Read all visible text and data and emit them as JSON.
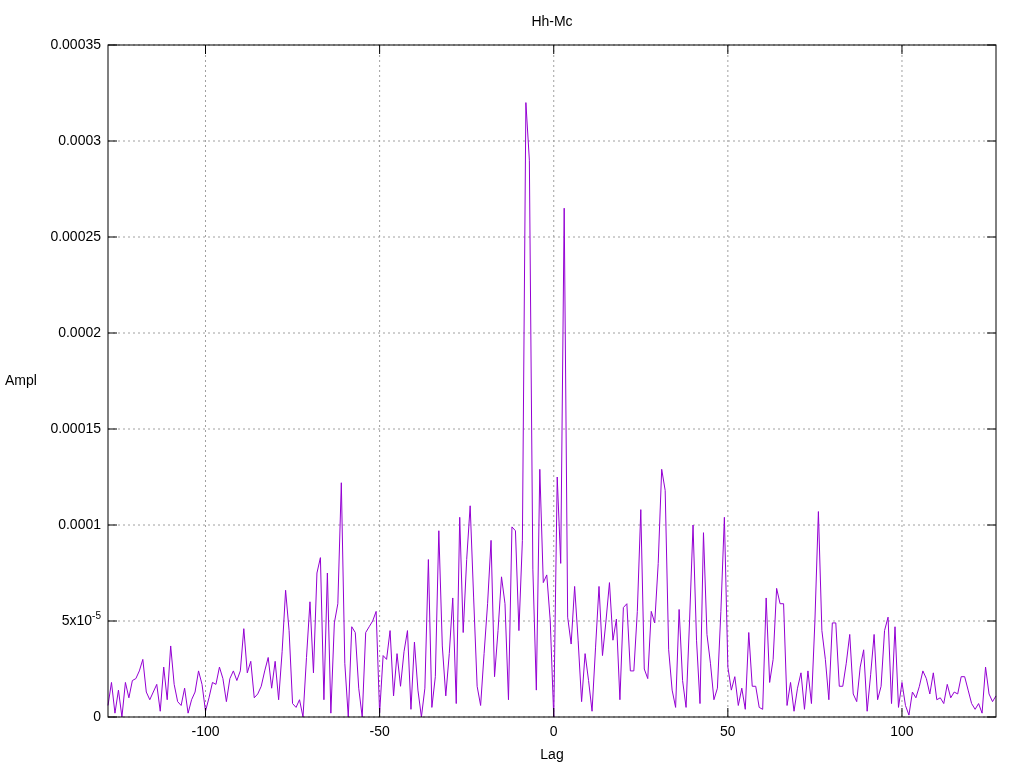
{
  "plot": {
    "chart_data": {
      "type": "line",
      "title": "Hh-Mc",
      "xlabel": "Lag",
      "ylabel": "Ampl",
      "xlim": [
        -128,
        127
      ],
      "ylim": [
        0,
        0.00035
      ],
      "grid": true,
      "xticks": [
        -100,
        -50,
        0,
        50,
        100
      ],
      "yticks": [
        {
          "value": 0,
          "label": "0"
        },
        {
          "value": 5e-05,
          "label": "5x10$^{-5}$"
        },
        {
          "value": 0.0001,
          "label": "0.0001"
        },
        {
          "value": 0.00015,
          "label": "0.00015"
        },
        {
          "value": 0.0002,
          "label": "0.0002"
        },
        {
          "value": 0.00025,
          "label": "0.00025"
        },
        {
          "value": 0.0003,
          "label": "0.0003"
        },
        {
          "value": 0.00035,
          "label": "0.00035"
        }
      ],
      "x": [
        -128,
        -127,
        -126,
        -125,
        -124,
        -123,
        -122,
        -121,
        -120,
        -119,
        -118,
        -117,
        -116,
        -115,
        -114,
        -113,
        -112,
        -111,
        -110,
        -109,
        -108,
        -107,
        -106,
        -105,
        -104,
        -103,
        -102,
        -101,
        -100,
        -99,
        -98,
        -97,
        -96,
        -95,
        -94,
        -93,
        -92,
        -91,
        -90,
        -89,
        -88,
        -87,
        -86,
        -85,
        -84,
        -83,
        -82,
        -81,
        -80,
        -79,
        -78,
        -77,
        -76,
        -75,
        -74,
        -73,
        -72,
        -71,
        -70,
        -69,
        -68,
        -67,
        -66,
        -65,
        -64,
        -63,
        -62,
        -61,
        -60,
        -59,
        -58,
        -57,
        -56,
        -55,
        -54,
        -53,
        -52,
        -51,
        -50,
        -49,
        -48,
        -47,
        -46,
        -45,
        -44,
        -43,
        -42,
        -41,
        -40,
        -39,
        -38,
        -37,
        -36,
        -35,
        -34,
        -33,
        -32,
        -31,
        -30,
        -29,
        -28,
        -27,
        -26,
        -25,
        -24,
        -23,
        -22,
        -21,
        -20,
        -19,
        -18,
        -17,
        -16,
        -15,
        -14,
        -13,
        -12,
        -11,
        -10,
        -9,
        -8,
        -7,
        -6,
        -5,
        -4,
        -3,
        -2,
        -1,
        0,
        1,
        2,
        3,
        4,
        5,
        6,
        7,
        8,
        9,
        10,
        11,
        12,
        13,
        14,
        15,
        16,
        17,
        18,
        19,
        20,
        21,
        22,
        23,
        24,
        25,
        26,
        27,
        28,
        29,
        30,
        31,
        32,
        33,
        34,
        35,
        36,
        37,
        38,
        39,
        40,
        41,
        42,
        43,
        44,
        45,
        46,
        47,
        48,
        49,
        50,
        51,
        52,
        53,
        54,
        55,
        56,
        57,
        58,
        59,
        60,
        61,
        62,
        63,
        64,
        65,
        66,
        67,
        68,
        69,
        70,
        71,
        72,
        73,
        74,
        75,
        76,
        77,
        78,
        79,
        80,
        81,
        82,
        83,
        84,
        85,
        86,
        87,
        88,
        89,
        90,
        91,
        92,
        93,
        94,
        95,
        96,
        97,
        98,
        99,
        100,
        101,
        102,
        103,
        104,
        105,
        106,
        107,
        108,
        109,
        110,
        111,
        112,
        113,
        114,
        115,
        116,
        117,
        118,
        119,
        120,
        121,
        122,
        123,
        124,
        125,
        126,
        127
      ],
      "series": [
        {
          "color": "#9400d3",
          "values": [
            6e-06,
            1.8e-05,
            2e-06,
            1.4e-05,
            0,
            1.8e-05,
            1e-05,
            1.9e-05,
            2e-05,
            2.4e-05,
            3e-05,
            1.3e-05,
            9e-06,
            1.3e-05,
            1.7e-05,
            3e-06,
            2.6e-05,
            9e-06,
            3.7e-05,
            1.7e-05,
            8e-06,
            6e-06,
            1.5e-05,
            2e-06,
            9e-06,
            1.3e-05,
            2.4e-05,
            1.7e-05,
            3e-06,
            1e-05,
            1.8e-05,
            1.7e-05,
            2.6e-05,
            2e-05,
            8e-06,
            2e-05,
            2.4e-05,
            1.9e-05,
            2.4e-05,
            4.6e-05,
            2.3e-05,
            2.9e-05,
            1e-05,
            1.2e-05,
            1.6e-05,
            2.4e-05,
            3.1e-05,
            1.5e-05,
            2.9e-05,
            9e-06,
            3.4e-05,
            6.6e-05,
            4.5e-05,
            7e-06,
            5e-06,
            9e-06,
            0,
            3.1e-05,
            6e-05,
            2.3e-05,
            7.5e-05,
            8.3e-05,
            9e-06,
            7.5e-05,
            2e-06,
            4.9e-05,
            5.9e-05,
            0.000122,
            2.8e-05,
            0,
            4.7e-05,
            4.4e-05,
            1.5e-05,
            0,
            4.4e-05,
            4.7e-05,
            5e-05,
            5.5e-05,
            2e-06,
            3.2e-05,
            3e-05,
            4.5e-05,
            1.1e-05,
            3.3e-05,
            1.6e-05,
            3.4e-05,
            4.5e-05,
            4e-06,
            3.9e-05,
            1.4e-05,
            0,
            1.5e-05,
            8.2e-05,
            5e-06,
            2.1e-05,
            9.7e-05,
            3.7e-05,
            1.1e-05,
            3.3e-05,
            6.2e-05,
            7e-06,
            0.000104,
            4.4e-05,
            8.2e-05,
            0.00011,
            6.2e-05,
            1.6e-05,
            6e-06,
            3.3e-05,
            5.9e-05,
            9.2e-05,
            2.1e-05,
            4.5e-05,
            7.3e-05,
            5.9e-05,
            9e-06,
            9.9e-05,
            9.7e-05,
            4.5e-05,
            9.2e-05,
            0.00032,
            0.00029,
            7.7e-05,
            1.4e-05,
            0.000129,
            7e-05,
            7.4e-05,
            5e-05,
            0,
            0.000125,
            8e-05,
            0.000265,
            5.2e-05,
            3.8e-05,
            6.8e-05,
            4e-05,
            8e-06,
            3.3e-05,
            1.9e-05,
            3e-06,
            3.6e-05,
            6.8e-05,
            3.2e-05,
            5e-05,
            7e-05,
            4e-05,
            5.1e-05,
            9e-06,
            5.7e-05,
            5.9e-05,
            2.4e-05,
            2.4e-05,
            5.5e-05,
            0.000108,
            2.5e-05,
            2e-05,
            5.5e-05,
            4.9e-05,
            8e-05,
            0.000129,
            0.000118,
            3.5e-05,
            1.4e-05,
            5e-06,
            5.6e-05,
            1.9e-05,
            5e-06,
            5e-05,
            0.0001,
            4e-05,
            7e-06,
            9.6e-05,
            4.3e-05,
            2.8e-05,
            9e-06,
            1.5e-05,
            5.5e-05,
            0.000104,
            2.6e-05,
            1.4e-05,
            2.1e-05,
            6e-06,
            1.5e-05,
            4e-06,
            4.4e-05,
            1.6e-05,
            1.6e-05,
            5e-06,
            4e-06,
            6.2e-05,
            1.8e-05,
            3e-05,
            6.7e-05,
            5.9e-05,
            5.9e-05,
            6e-06,
            1.8e-05,
            3e-06,
            1.5e-05,
            2.3e-05,
            4e-06,
            2.4e-05,
            7e-06,
            5e-05,
            0.000107,
            4.5e-05,
            3e-05,
            9e-06,
            4.9e-05,
            4.9e-05,
            1.6e-05,
            1.6e-05,
            2.8e-05,
            4.3e-05,
            1.2e-05,
            8e-06,
            2.6e-05,
            3.5e-05,
            3e-06,
            2.2e-05,
            4.3e-05,
            9e-06,
            1.6e-05,
            4.5e-05,
            5.2e-05,
            7e-06,
            4.7e-05,
            5e-06,
            1.8e-05,
            6e-06,
            1e-06,
            1.3e-05,
            1e-05,
            1.6e-05,
            2.4e-05,
            2e-05,
            1.2e-05,
            2.3e-05,
            9e-06,
            1e-05,
            7e-06,
            1.7e-05,
            1e-05,
            1.3e-05,
            1.2e-05,
            2.1e-05,
            2.1e-05,
            1.4e-05,
            7e-06,
            4e-06,
            7e-06,
            2e-06,
            2.6e-05,
            1.2e-05,
            8e-06,
            1.1e-05
          ]
        }
      ]
    }
  }
}
